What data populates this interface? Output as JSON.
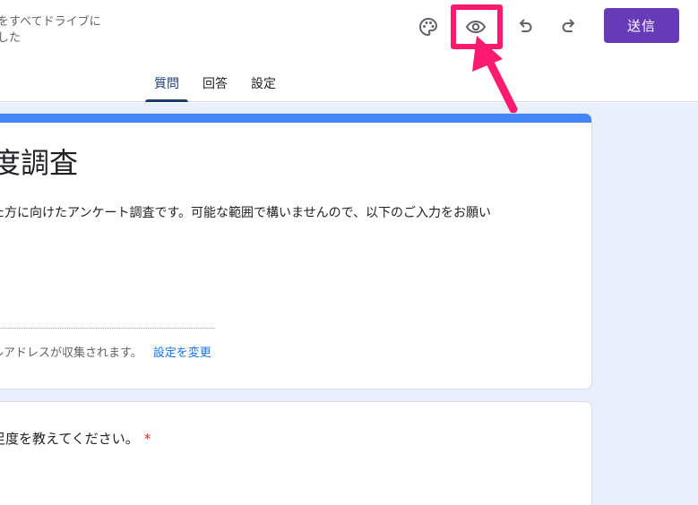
{
  "header": {
    "save_status_line1": "をすべてドライブに",
    "save_status_line2": "した",
    "icons": [
      "palette-icon",
      "eye-icon",
      "undo-icon",
      "redo-icon"
    ],
    "send_label": "送信"
  },
  "tabs": [
    {
      "label": "質問",
      "active": true
    },
    {
      "label": "回答",
      "active": false
    },
    {
      "label": "設定",
      "active": false
    }
  ],
  "form": {
    "title": "度調査",
    "description": "た方に向けたアンケート調査です。可能な範囲で構いませんので、以下のご入力をお願い",
    "email_notice": "ルアドレスが収集されます。",
    "change_settings_link": "設定を変更"
  },
  "question": {
    "text": "足度を教えてください。",
    "required_mark": "*"
  },
  "colors": {
    "accent": "#673ab7",
    "title_bar": "#4285f4",
    "canvas_bg": "#e8effd",
    "annotation": "#ff1a6f",
    "link": "#1a73e8"
  }
}
